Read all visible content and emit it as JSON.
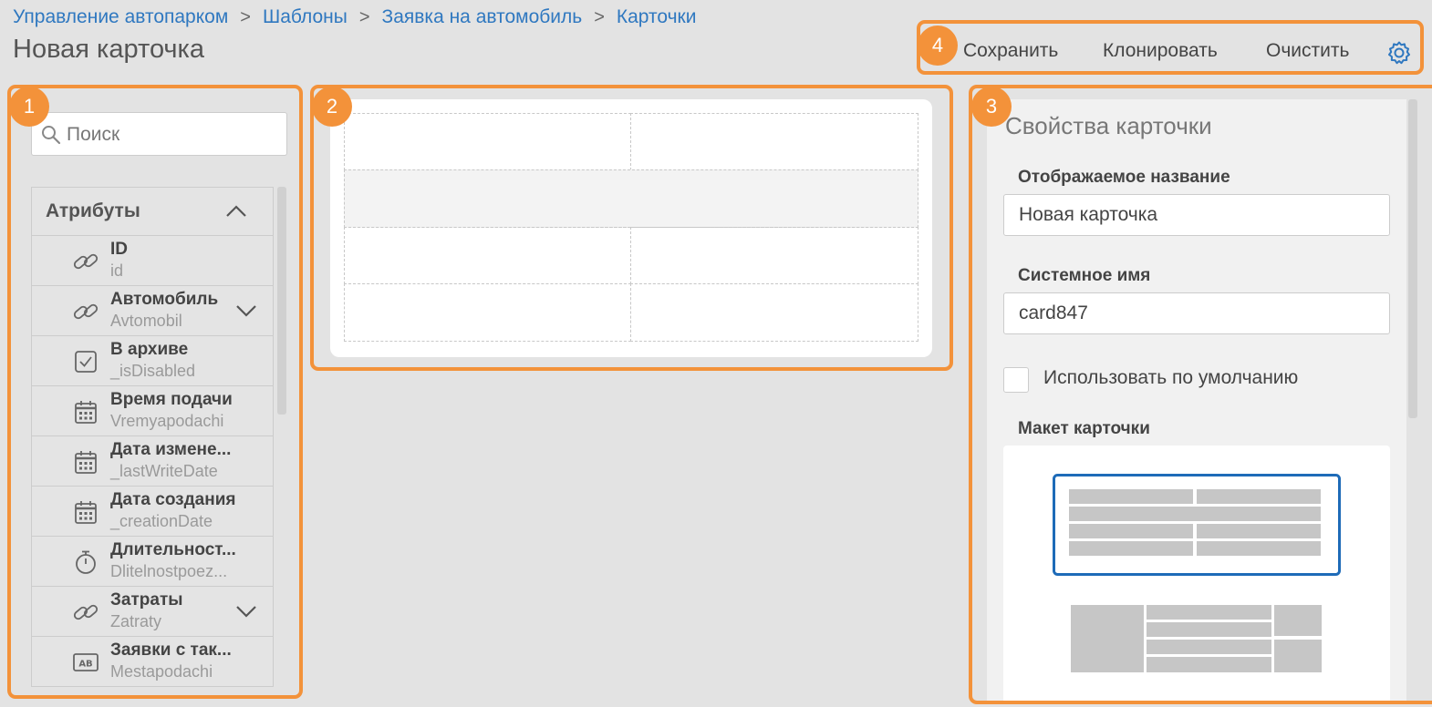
{
  "breadcrumb": [
    "Управление автопарком",
    "Шаблоны",
    "Заявка на автомобиль",
    "Карточки"
  ],
  "page_title": "Новая карточка",
  "badges": [
    "1",
    "2",
    "3",
    "4"
  ],
  "toolbar": {
    "save_label": "Сохранить",
    "clone_label": "Клонировать",
    "clear_label": "Очистить"
  },
  "search": {
    "placeholder": "Поиск"
  },
  "attributes": {
    "header": "Атрибуты",
    "items": [
      {
        "name": "ID",
        "system": "id",
        "icon": "link-icon"
      },
      {
        "name": "Автомобиль",
        "system": "Avtomobil",
        "icon": "link-icon"
      },
      {
        "name": "В архиве",
        "system": "_isDisabled",
        "icon": "checkbox-icon"
      },
      {
        "name": "Время подачи",
        "system": "Vremyapodachi",
        "icon": "calendar-icon"
      },
      {
        "name": "Дата измене...",
        "system": "_lastWriteDate",
        "icon": "calendar-icon"
      },
      {
        "name": "Дата создания",
        "system": "_creationDate",
        "icon": "calendar-icon"
      },
      {
        "name": "Длительност...",
        "system": "Dlitelnostpoez...",
        "icon": "stopwatch-icon"
      },
      {
        "name": "Затраты",
        "system": "Zatraty",
        "icon": "link-icon"
      },
      {
        "name": "Заявки с так...",
        "system": "Mestapodachi",
        "icon": "text-icon"
      }
    ]
  },
  "properties": {
    "title": "Свойства карточки",
    "display_name_label": "Отображаемое название",
    "display_name_value": "Новая карточка",
    "system_name_label": "Системное имя",
    "system_name_value": "card847",
    "default_checkbox_label": "Использовать по умолчанию",
    "layout_label": "Макет карточки"
  },
  "colors": {
    "accent": "#f3923a",
    "link": "#2f78c0",
    "selected_layout": "#1e6bb8"
  }
}
